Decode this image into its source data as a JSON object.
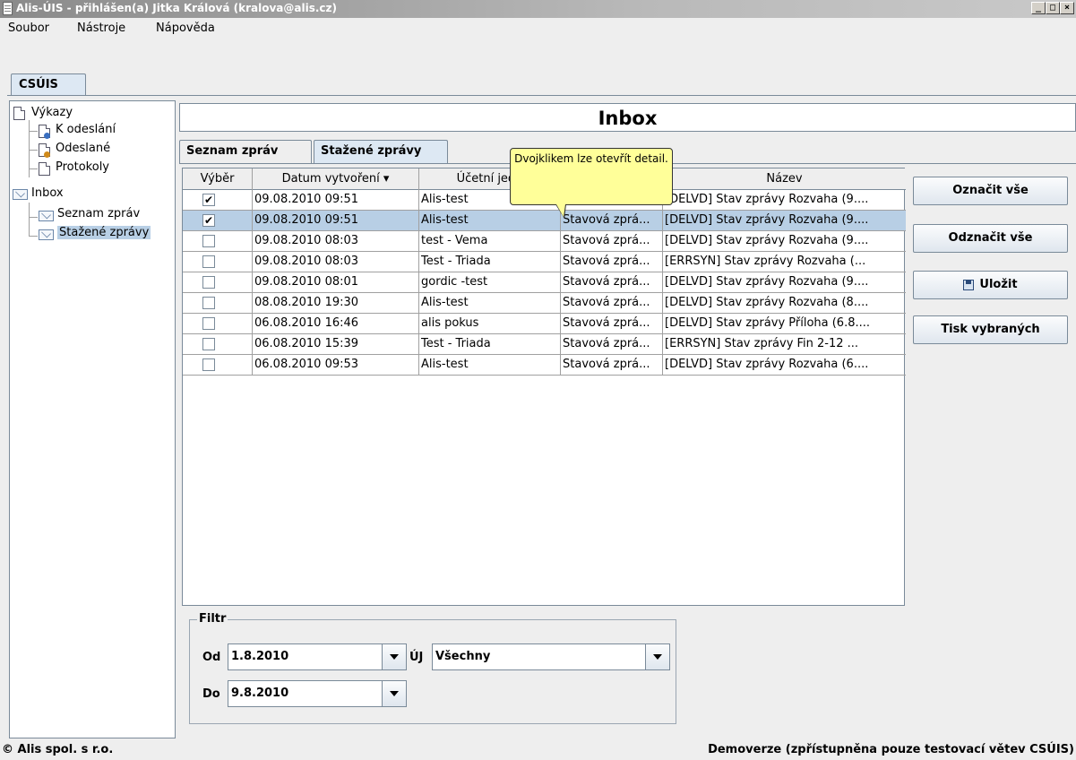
{
  "window": {
    "title": "Alis-ÚIS - přihlášen(a) Jitka Králová (kralova@alis.cz)",
    "controls": [
      "_",
      "□",
      "×"
    ]
  },
  "menu": [
    "Soubor",
    "Nástroje",
    "Nápověda"
  ],
  "outer_tab": "CSÚIS",
  "tree": {
    "vykazy": "Výkazy",
    "k_odeslani": "K odeslání",
    "odeslane": "Odeslané",
    "protokoly": "Protokoly",
    "inbox": "Inbox",
    "seznam_zprav": "Seznam zpráv",
    "stazene_zpravy": "Stažené zprávy"
  },
  "header": {
    "title": "Inbox"
  },
  "tabs": [
    {
      "label": "Seznam zpráv",
      "active": false
    },
    {
      "label": "Stažené zprávy",
      "active": true
    }
  ],
  "table": {
    "columns": [
      "Výběr",
      "Datum vytvoření ▾",
      "Účetní jedn",
      "",
      "Název"
    ],
    "rows": [
      {
        "checked": true,
        "date": "09.08.2010 09:51",
        "unit": "Alis-test",
        "type": "Stavová zprá...",
        "name": "[DELVD] Stav zprávy Rozvaha (9....",
        "selected": false
      },
      {
        "checked": true,
        "date": "09.08.2010 09:51",
        "unit": "Alis-test",
        "type": "Stavová zprá...",
        "name": "[DELVD] Stav zprávy Rozvaha (9....",
        "selected": true
      },
      {
        "checked": false,
        "date": "09.08.2010 08:03",
        "unit": "test - Vema",
        "type": "Stavová zprá...",
        "name": "[DELVD] Stav zprávy Rozvaha (9....",
        "selected": false
      },
      {
        "checked": false,
        "date": "09.08.2010 08:03",
        "unit": "Test - Triada",
        "type": "Stavová zprá...",
        "name": "[ERRSYN] Stav zprávy Rozvaha (...",
        "selected": false
      },
      {
        "checked": false,
        "date": "09.08.2010 08:01",
        "unit": "gordic -test",
        "type": "Stavová zprá...",
        "name": "[DELVD] Stav zprávy Rozvaha (9....",
        "selected": false
      },
      {
        "checked": false,
        "date": "08.08.2010 19:30",
        "unit": "Alis-test",
        "type": "Stavová zprá...",
        "name": "[DELVD] Stav zprávy Rozvaha (8....",
        "selected": false
      },
      {
        "checked": false,
        "date": "06.08.2010 16:46",
        "unit": "alis pokus",
        "type": "Stavová zprá...",
        "name": "[DELVD] Stav zprávy Příloha (6.8....",
        "selected": false
      },
      {
        "checked": false,
        "date": "06.08.2010 15:39",
        "unit": "Test - Triada",
        "type": "Stavová zprá...",
        "name": "[ERRSYN] Stav zprávy Fin 2-12 ...",
        "selected": false
      },
      {
        "checked": false,
        "date": "06.08.2010 09:53",
        "unit": "Alis-test",
        "type": "Stavová zprá...",
        "name": "[DELVD] Stav zprávy Rozvaha (6....",
        "selected": false
      }
    ]
  },
  "tooltip": "Dvojklikem lze otevřít detail.",
  "buttons": {
    "select_all": "Označit vše",
    "deselect_all": "Odznačit vše",
    "save": "Uložit",
    "print_selected": "Tisk vybraných"
  },
  "filter": {
    "legend": "Filtr",
    "od_label": "Od",
    "od_value": "1.8.2010",
    "do_label": "Do",
    "do_value": "9.8.2010",
    "uj_label": "ÚJ",
    "uj_value": "Všechny"
  },
  "status": {
    "left": "© Alis spol. s r.o.",
    "right": "Demoverze (zpřístupněna pouze testovací větev CSÚIS)"
  }
}
